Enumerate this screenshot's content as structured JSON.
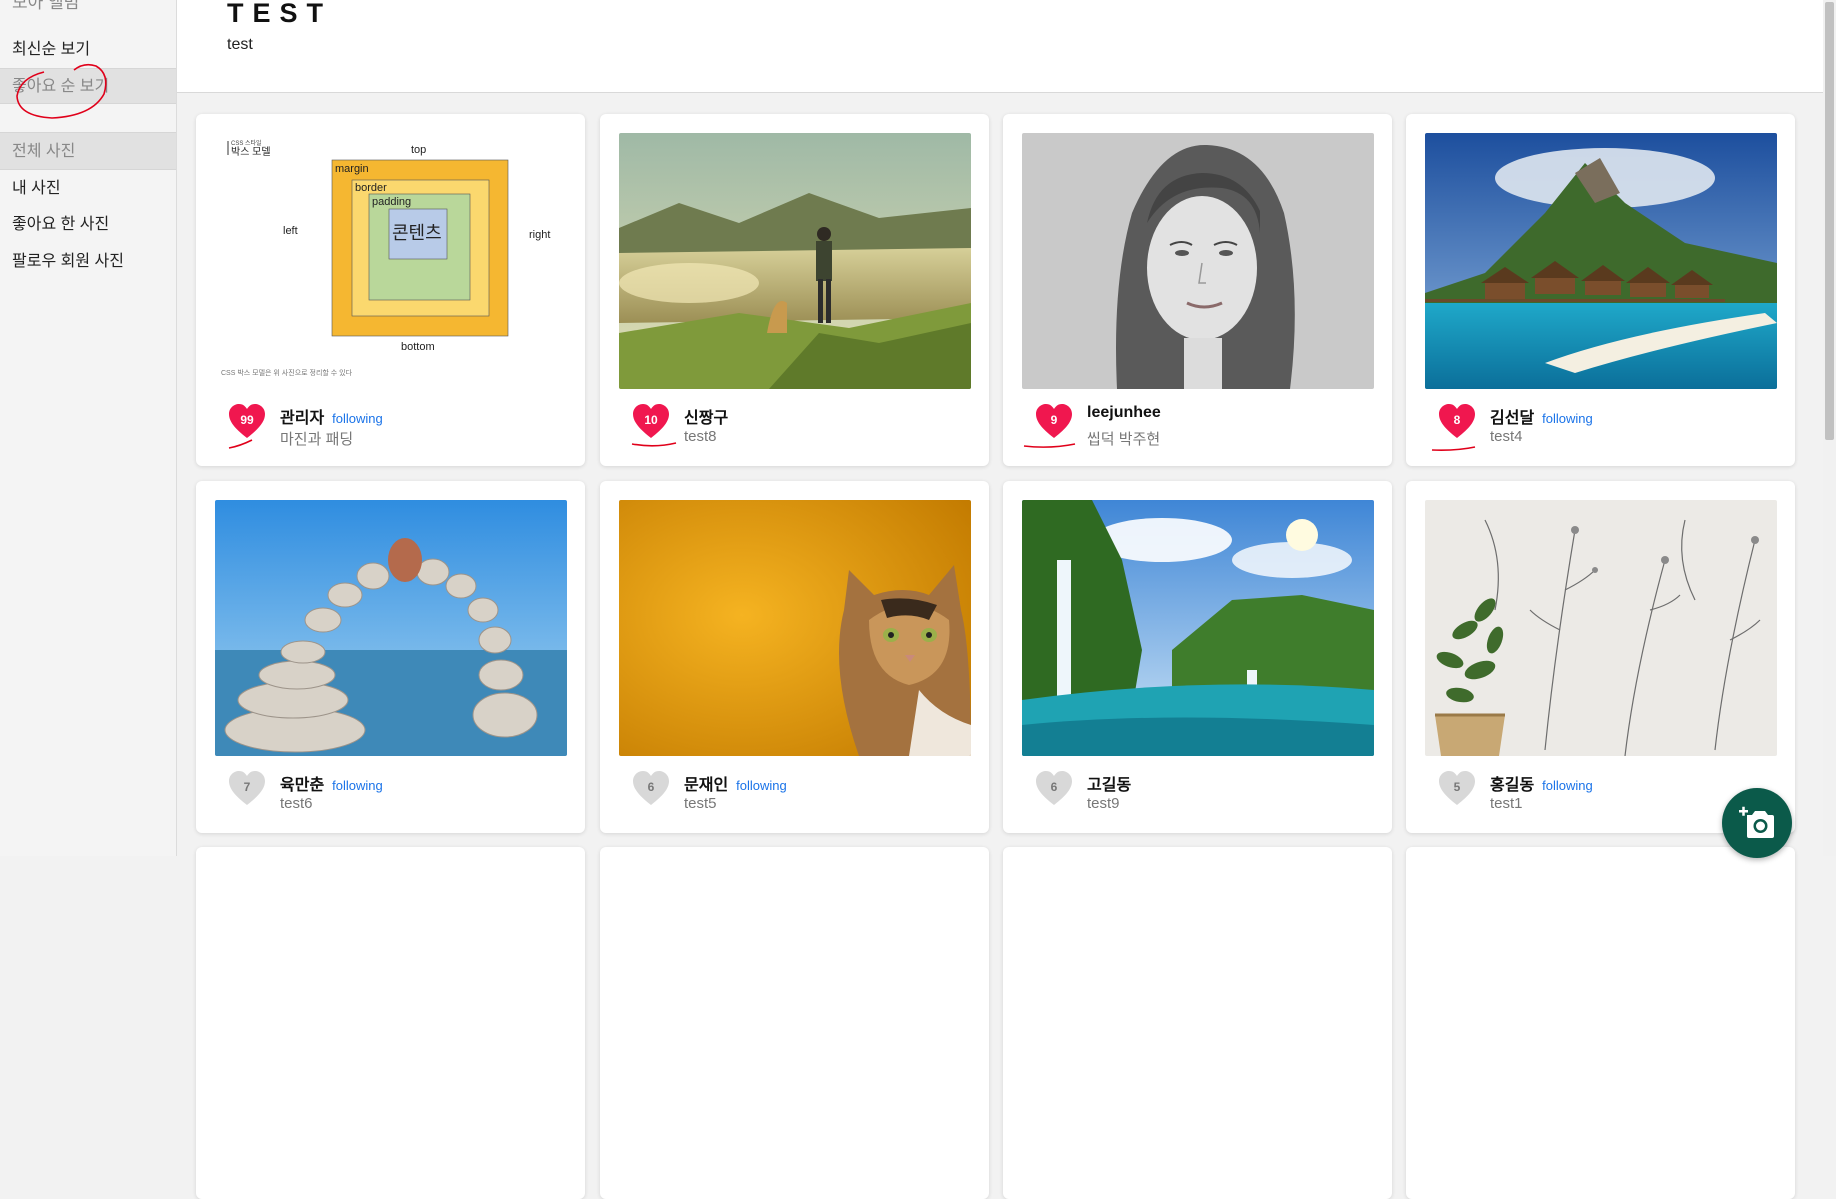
{
  "sidebar": {
    "top_label": "모아 앨범",
    "sort_latest": "최신순 보기",
    "sort_likes": "좋아요 순 보기",
    "section_all": "전체 사진",
    "my_photos": "내 사진",
    "liked_photos": "좋아요 한 사진",
    "following_photos": "팔로우 회원 사진"
  },
  "header": {
    "brand": "TEST",
    "subtitle": "test"
  },
  "box_model": {
    "tag": "CSS 스타일",
    "title": "박스 모델",
    "top": "top",
    "left": "left",
    "right": "right",
    "bottom": "bottom",
    "margin": "margin",
    "border": "border",
    "padding": "padding",
    "content": "콘텐츠",
    "note": "CSS 박스 모델은 위 사진으로 정리할 수 있다"
  },
  "posts": [
    {
      "likes": "99",
      "liked": true,
      "author": "관리자",
      "following": "following",
      "caption": "마진과 패딩",
      "image": "box-model-diagram"
    },
    {
      "likes": "10",
      "liked": true,
      "author": "신짱구",
      "following": "",
      "caption": "test8",
      "image": "hiker-with-dog-on-hill"
    },
    {
      "likes": "9",
      "liked": true,
      "author": "leejunhee",
      "following": "",
      "caption": "씹덕 박주현",
      "image": "pencil-portrait"
    },
    {
      "likes": "8",
      "liked": true,
      "author": "김선달",
      "following": "following",
      "caption": "test4",
      "image": "tropical-island-bungalows"
    },
    {
      "likes": "7",
      "liked": false,
      "author": "육만춘",
      "following": "following",
      "caption": "test6",
      "image": "stacked-stone-arch"
    },
    {
      "likes": "6",
      "liked": false,
      "author": "문재인",
      "following": "following",
      "caption": "test5",
      "image": "cat-on-yellow"
    },
    {
      "likes": "6",
      "liked": false,
      "author": "고길동",
      "following": "",
      "caption": "test9",
      "image": "waterfall-lake"
    },
    {
      "likes": "5",
      "liked": false,
      "author": "홍길동",
      "following": "following",
      "caption": "test1",
      "image": "botanical-wall-with-plant"
    }
  ],
  "colors": {
    "heart_liked": "#f0174f",
    "heart_unliked": "#d8d8d8",
    "follow_link": "#1a73e8",
    "fab": "#0b5a4a",
    "annotation": "#e0001a"
  },
  "fab_icon": "add-photo-icon"
}
